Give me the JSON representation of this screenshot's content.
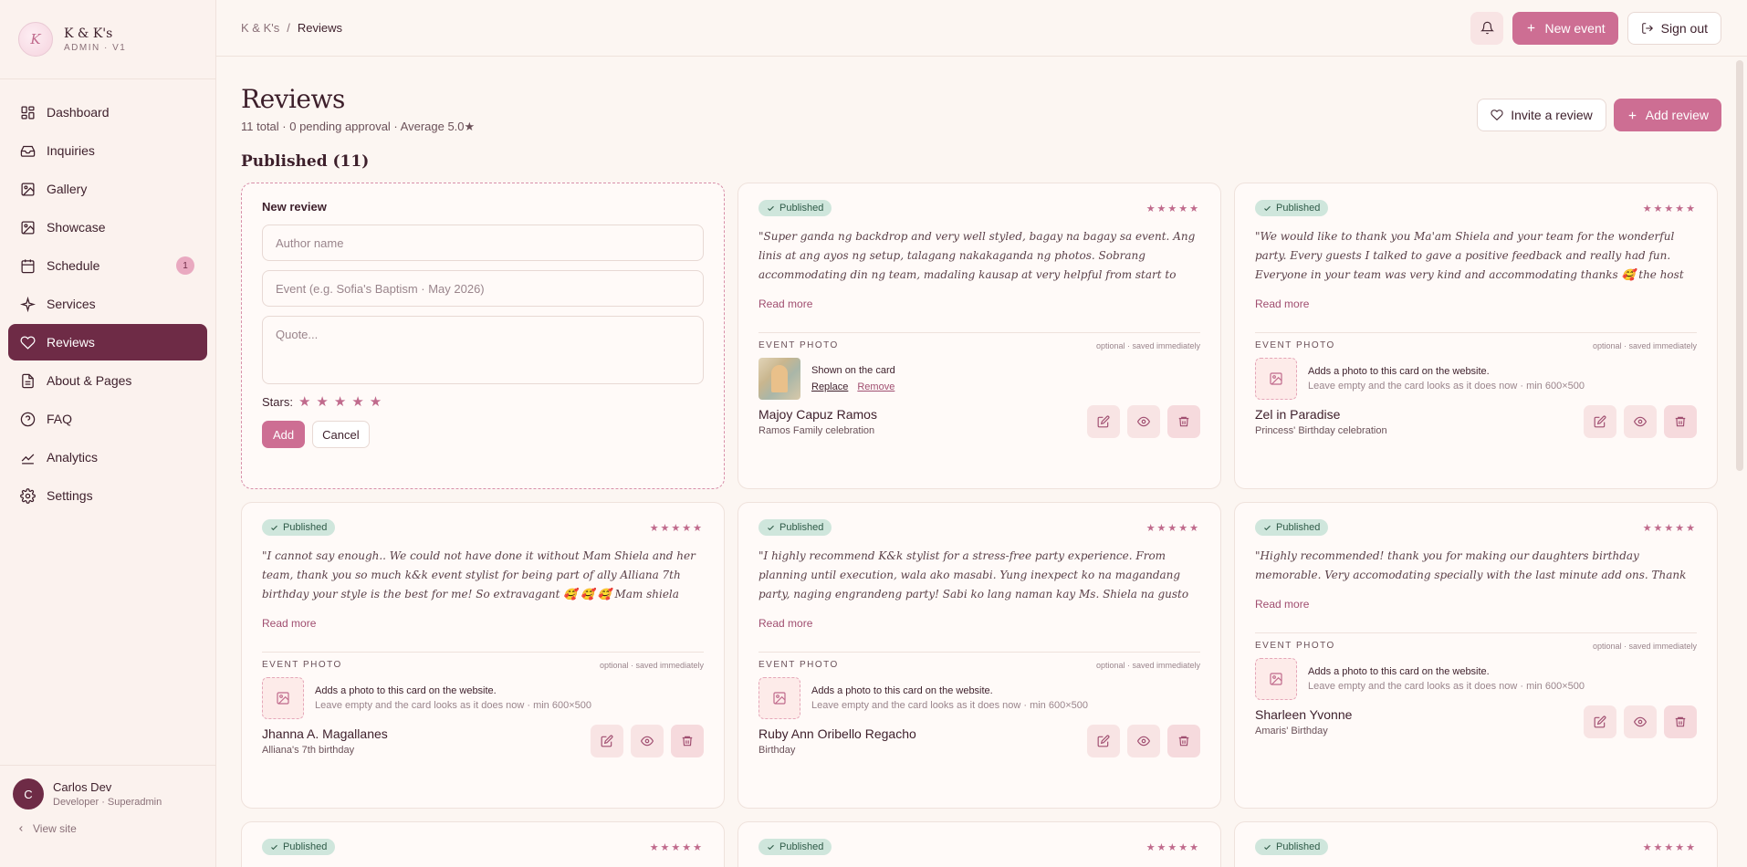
{
  "brand": {
    "name": "K & K's",
    "sub": "ADMIN · V1",
    "logo_text": "K"
  },
  "nav": [
    {
      "label": "Dashboard",
      "icon": "dashboard-icon",
      "active": false
    },
    {
      "label": "Inquiries",
      "icon": "inbox-icon",
      "active": false
    },
    {
      "label": "Gallery",
      "icon": "image-icon",
      "active": false
    },
    {
      "label": "Showcase",
      "icon": "image-icon",
      "active": false
    },
    {
      "label": "Schedule",
      "icon": "calendar-icon",
      "active": false,
      "badge": "1"
    },
    {
      "label": "Services",
      "icon": "sparkle-icon",
      "active": false
    },
    {
      "label": "Reviews",
      "icon": "heart-icon",
      "active": true
    },
    {
      "label": "About & Pages",
      "icon": "file-icon",
      "active": false
    },
    {
      "label": "FAQ",
      "icon": "help-icon",
      "active": false
    },
    {
      "label": "Analytics",
      "icon": "chart-line-icon",
      "active": false
    },
    {
      "label": "Settings",
      "icon": "gear-icon",
      "active": false
    }
  ],
  "user": {
    "initial": "C",
    "name": "Carlos Dev",
    "role": "Developer · Superadmin",
    "view_site": "View site"
  },
  "topbar": {
    "breadcrumb_root": "K & K's",
    "breadcrumb_sep": "/",
    "breadcrumb_current": "Reviews",
    "new_event": "New event",
    "sign_out": "Sign out"
  },
  "page": {
    "title": "Reviews",
    "subtitle": "11 total · 0 pending approval · Average 5.0★",
    "invite": "Invite a review",
    "add": "Add review",
    "section": "Published (11)"
  },
  "new_review": {
    "title": "New review",
    "author_placeholder": "Author name",
    "event_placeholder": "Event (e.g. Sofia's Baptism · May 2026)",
    "quote_placeholder": "Quote...",
    "stars_label": "Stars:",
    "stars": "★",
    "add": "Add",
    "cancel": "Cancel"
  },
  "labels": {
    "published": "Published",
    "rating": "★★★★★",
    "read_more": "Read more",
    "event_photo": "EVENT PHOTO",
    "photo_optional": "optional · saved immediately",
    "photo_add_line1": "Adds a photo to this card on the website.",
    "photo_add_line2": "Leave empty and the card looks as it does now · min 600×500",
    "photo_shown": "Shown on the card",
    "replace": "Replace",
    "remove": "Remove"
  },
  "reviews": [
    {
      "quote": "\"Super ganda ng backdrop and very well styled, bagay na bagay sa event. Ang linis at ang ayos ng setup, talagang nakakaganda ng photos. Sobrang accommodating din ng team, madaling kausap at very helpful from start to finish. Thank you for the great service!\"",
      "author": "Majoy Capuz Ramos",
      "event": "Ramos Family celebration",
      "has_photo": true
    },
    {
      "quote": "\"We would like to thank you Ma'am Shiela and your team for the wonderful party. Every guests I talked to gave a positive feedback and really had fun. Everyone in your team was very kind and accommodating thanks 🥰 the host was very entertaining and made the party more lively. The...",
      "author": "Zel in Paradise",
      "event": "Princess' Birthday celebration",
      "has_photo": false
    },
    {
      "quote": "\"I cannot say enough.. We could not have done it without Mam Shiela and her team, thank you so much k&k event stylist for being part of ally Alliana 7th birthday your style is the best for me! So extravagant 🥰 🥰 🥰 Mam shiela handled everything, no hassle napaka hands on even during...",
      "author": "Jhanna A. Magallanes",
      "event": "Alliana's 7th birthday",
      "has_photo": false
    },
    {
      "quote": "\"I highly recommend K&k stylist for a stress-free party experience. From planning until execution, wala ako masabi. Yung inexpect ko na magandang party, naging engrandeng party! Sabi ko lang naman kay Ms. Shiela na gusto ko unique Backdrop. Encanto or mermaid or unicorn party. They...",
      "author": "Ruby Ann Oribello Regacho",
      "event": "Birthday",
      "has_photo": false
    },
    {
      "quote": "\"Highly recommended! thank you for making our daughters birthday memorable. Very accomodating specially with the last minute add ons. Thank you very much 🖤\"",
      "author": "Sharleen Yvonne",
      "event": "Amaris' Birthday",
      "has_photo": false
    }
  ],
  "colors": {
    "accent": "#cd6e93",
    "active_nav": "#6e2b46",
    "published_bg": "#cfe6dc",
    "background": "#fcf6f2"
  }
}
